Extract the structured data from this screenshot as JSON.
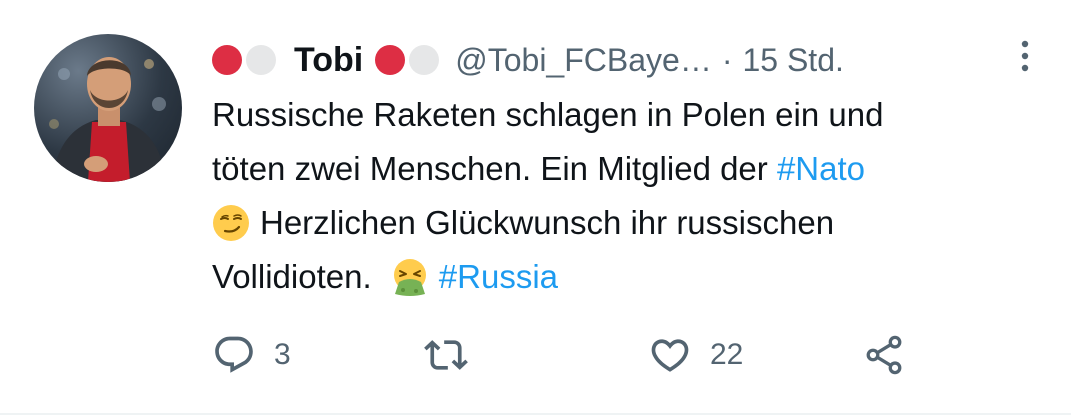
{
  "tweet": {
    "author": {
      "display_name": "Tobi",
      "handle": "@Tobi_FCBaye…",
      "time": "15 Std.",
      "separator": "·",
      "name_emojis_before": [
        "red-circle",
        "white-circle"
      ],
      "name_emojis_after": [
        "red-circle",
        "white-circle"
      ]
    },
    "text": {
      "line1": "Russische Raketen schlagen in Polen ein und",
      "line2_text": "töten zwei Menschen. Ein Mitglied der ",
      "line2_hashtag": "#Nato",
      "line3_text": "Herzlichen Glückwunsch ihr russischen",
      "line4_text": "Vollidioten.",
      "line4_hashtag": "#Russia"
    },
    "actions": {
      "reply_count": "3",
      "retweet_count": "",
      "like_count": "22"
    }
  },
  "colors": {
    "text": "#0f1419",
    "secondary": "#536471",
    "link": "#1d9bf0",
    "red_circle": "#dd2e44",
    "white_circle": "#e6e7e8"
  },
  "icons": {
    "more": "more-vertical-icon",
    "reply": "reply-icon",
    "retweet": "retweet-icon",
    "like": "heart-icon",
    "share": "share-icon",
    "emoji_smirk": "smirking-face-emoji",
    "emoji_vomit": "vomiting-face-emoji"
  }
}
